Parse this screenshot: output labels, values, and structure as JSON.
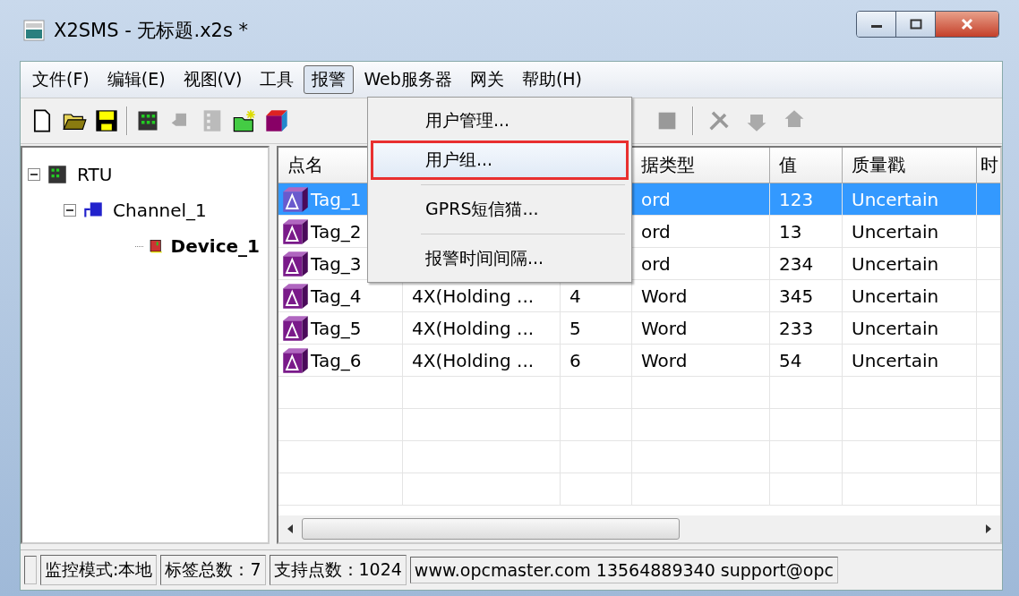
{
  "window": {
    "title": "X2SMS - 无标题.x2s *"
  },
  "menu_bar": [
    {
      "label": "文件(F)",
      "selected": false
    },
    {
      "label": "编辑(E)",
      "selected": false
    },
    {
      "label": "视图(V)",
      "selected": false
    },
    {
      "label": "工具",
      "selected": false
    },
    {
      "label": "报警",
      "selected": true
    },
    {
      "label": "Web服务器",
      "selected": false
    },
    {
      "label": "网关",
      "selected": false
    },
    {
      "label": "帮助(H)",
      "selected": false
    }
  ],
  "dropdown_menu": [
    {
      "label": "用户管理...",
      "selected": false
    },
    {
      "label": "用户组...",
      "selected": true
    },
    {
      "label": "GPRS短信猫...",
      "selected": false
    },
    {
      "label": "报警时间间隔...",
      "selected": false
    }
  ],
  "tree": [
    {
      "label": "RTU",
      "kind": "rtu",
      "expanded": true,
      "children": [
        {
          "label": "Channel_1",
          "kind": "channel",
          "expanded": true,
          "children": [
            {
              "label": "Device_1",
              "kind": "device",
              "selected": true
            }
          ]
        }
      ]
    }
  ],
  "table": {
    "columns": [
      "点名",
      "据类型",
      "值",
      "质量戳",
      "时"
    ],
    "rows": [
      {
        "name": "Tag_1",
        "type": "ord",
        "value": "123",
        "quality": "Uncertain",
        "selected": true
      },
      {
        "name": "Tag_2",
        "type": "ord",
        "value": "13",
        "quality": "Uncertain",
        "selected": false
      },
      {
        "name": "Tag_3",
        "type": "ord",
        "value": "234",
        "quality": "Uncertain",
        "selected": false
      },
      {
        "name": "Tag_4",
        "address": "4X(Holding ...",
        "index": "4",
        "type": "Word",
        "value": "345",
        "quality": "Uncertain",
        "selected": false
      },
      {
        "name": "Tag_5",
        "address": "4X(Holding ...",
        "index": "5",
        "type": "Word",
        "value": "233",
        "quality": "Uncertain",
        "selected": false
      },
      {
        "name": "Tag_6",
        "address": "4X(Holding ...",
        "index": "6",
        "type": "Word",
        "value": "54",
        "quality": "Uncertain",
        "selected": false
      }
    ]
  },
  "status_bar": [
    "监控模式:本地",
    "标签总数：7",
    "支持点数：1024",
    "www.opcmaster.com 13564889340 support@opc"
  ]
}
